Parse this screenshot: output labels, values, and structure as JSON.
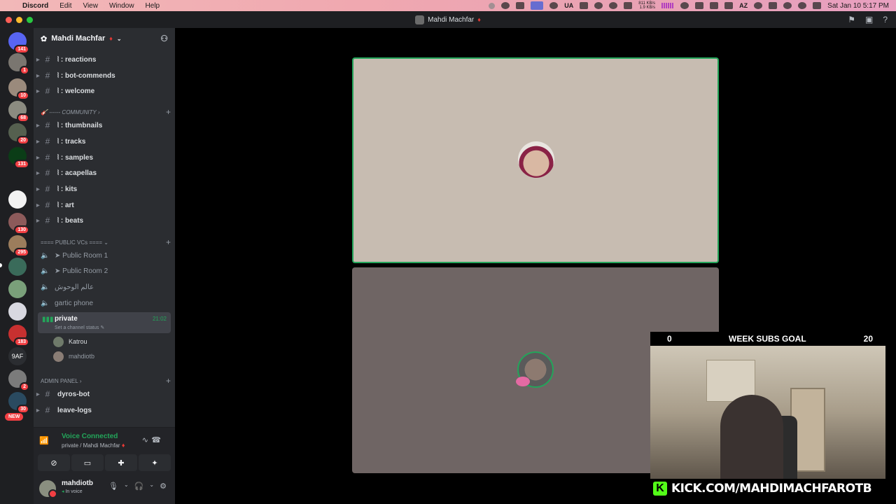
{
  "menubar": {
    "app_name": "Discord",
    "menus": [
      "Edit",
      "View",
      "Window",
      "Help"
    ],
    "lang": "UA",
    "net_up": "811 KB/s",
    "net_down": "1.9 KB/s",
    "kb_label": "AZ",
    "clock": "Sat Jan 10  5:17 PM"
  },
  "titlebar": {
    "title": "Mahdi Machfar"
  },
  "rail": {
    "badges": [
      "141",
      "1",
      "10",
      "68",
      "20",
      "131",
      "130",
      "295",
      "183",
      "2",
      "30"
    ],
    "text_server": "9AF",
    "new_label": "NEW"
  },
  "server": {
    "name": "Mahdi Machfar"
  },
  "channels_top": [
    {
      "label": "⦚ : reactions"
    },
    {
      "label": "⦚ : bot-commends"
    },
    {
      "label": "⦚ : welcome"
    }
  ],
  "category_community": "------ COMMUNITY",
  "channels_community": [
    {
      "label": "⦚ : thumbnails"
    },
    {
      "label": "⦚ : tracks"
    },
    {
      "label": "⦚ : samples"
    },
    {
      "label": "⦚ : acapellas"
    },
    {
      "label": "⦚ : kits"
    },
    {
      "label": "⦚ : art"
    },
    {
      "label": "⦚ : beats"
    }
  ],
  "category_public": "==== PUBLIC VCs ====",
  "voice_channels": [
    {
      "label": "➤ Public Room 1"
    },
    {
      "label": "➤ Public Room 2"
    },
    {
      "label": "عالم الوحوش"
    },
    {
      "label": "gartic phone"
    }
  ],
  "active_voice": {
    "name": "private",
    "status": "Set a channel status",
    "timer": "21:02",
    "members": [
      "Katrou",
      "mahdiotb"
    ]
  },
  "category_admin": "ADMIN PANEL",
  "channels_admin": [
    {
      "label": "dyros-bot"
    },
    {
      "label": "leave-logs"
    }
  ],
  "voice_panel": {
    "status": "Voice Connected",
    "location": "private / Mahdi Machfar"
  },
  "user": {
    "name": "mahdiotb",
    "sub": "In voice"
  },
  "overlay": {
    "goal_current": "0",
    "goal_label": "WEEK SUBS GOAL",
    "goal_target": "20",
    "kick_text": "KICK.COM/MAHDIMACHFAROTB",
    "kick_logo": "K"
  },
  "colors": {
    "accent_green": "#23a55a",
    "kick_green": "#53fc18",
    "badge_red": "#f23f43"
  }
}
